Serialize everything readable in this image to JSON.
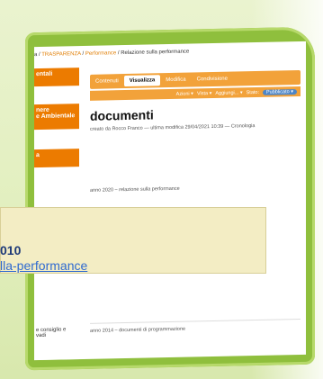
{
  "breadcrumb": {
    "prefix": "a / ",
    "section": "TRASPARENZA",
    "sep1": " / ",
    "subsection": "Performance",
    "sep2": " / ",
    "page": "Relazione sulla performance"
  },
  "left_nav": {
    "item1": "entali",
    "item2": "nere",
    "item3": "e Ambientale",
    "item4": "a",
    "bottom": "e consiglio e vadi"
  },
  "tabs": {
    "contents": "Contenuti",
    "view": "Visualizza",
    "edit": "Modifica",
    "sharing": "Condivisione"
  },
  "toolbar": {
    "actions": "Azioni ▾",
    "display": "Vista ▾",
    "add": "Aggiungi... ▾",
    "state_label": "Stato:",
    "publish": "Pubblicato ▾"
  },
  "document": {
    "title": "documenti",
    "meta": "creato da Rocco Franco — ultima modifica 29/04/2021 10:39 — Cronologia",
    "item1": "anno 2020 – relazione sulla performance",
    "item2": "anno 2014 – documenti di programmazione"
  },
  "overlay": {
    "line1": "010",
    "line2": "lla-performance"
  },
  "colors": {
    "accent_orange": "#ec7b00",
    "frame_green": "#8fbf3d",
    "overlay_bg": "#f3edc4",
    "link_blue": "#2f6ad0",
    "heading_navy": "#1e3a78"
  }
}
